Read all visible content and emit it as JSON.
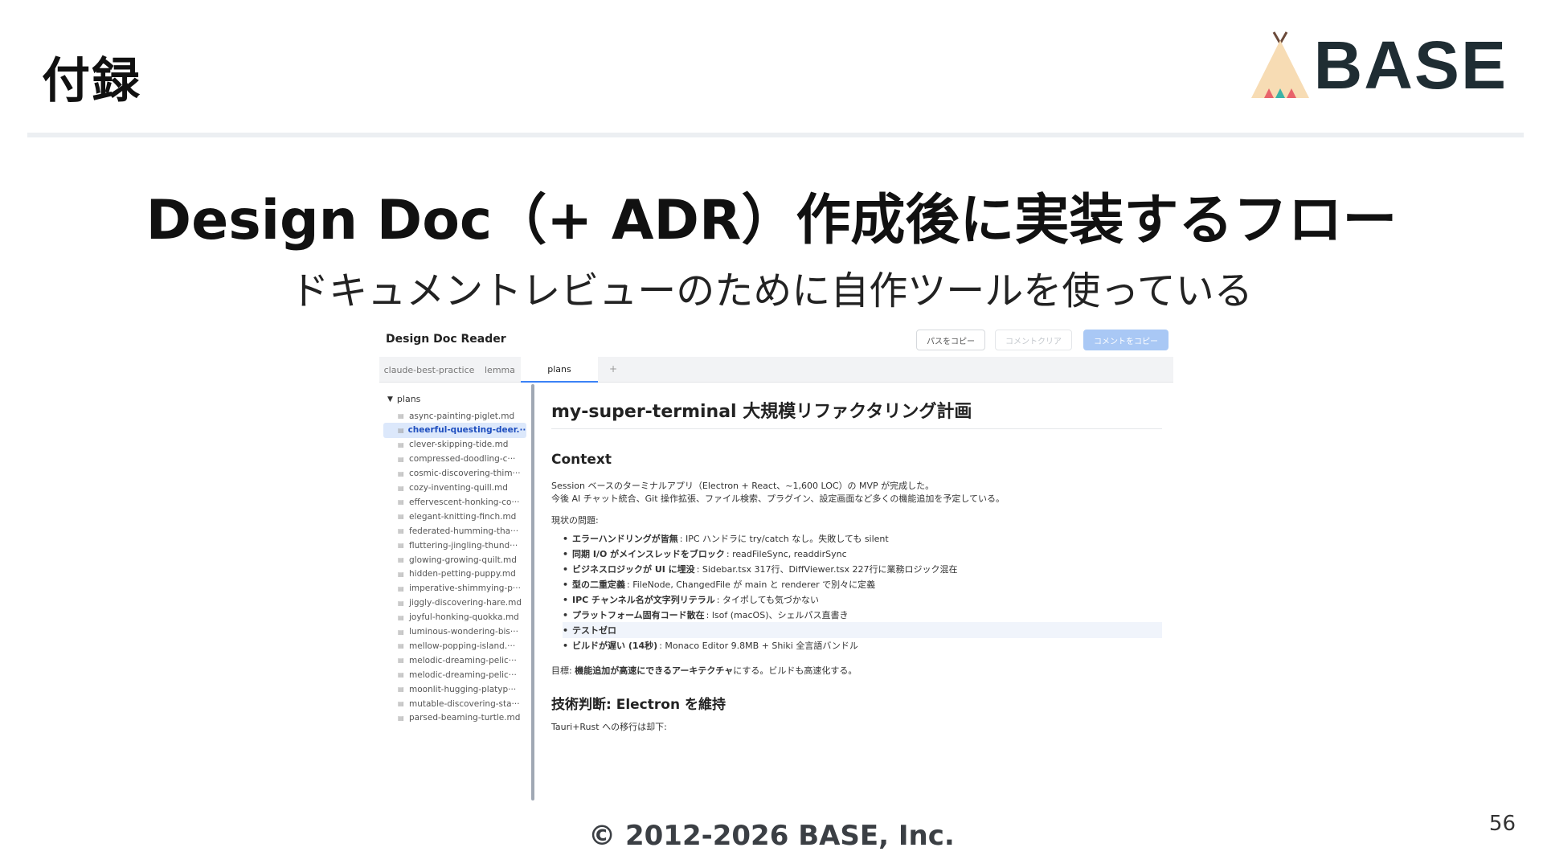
{
  "slide": {
    "heading": "付録",
    "logo_text": "BASE",
    "title": "Design Doc（+ ADR）作成後に実装するフロー",
    "subtitle": "ドキュメントレビューのために自作ツールを使っている",
    "copyright": "© 2012-2026 BASE, Inc.",
    "page_number": "56"
  },
  "app": {
    "title": "Design Doc Reader",
    "buttons": {
      "copy_path": "パスをコピー",
      "clear_comments": "コメントクリア",
      "copy_comments": "コメントをコピー"
    },
    "tabs": [
      {
        "label": "claude-best-practice"
      },
      {
        "label": "lemma"
      },
      {
        "label": "plans"
      }
    ],
    "tab_add": "+",
    "sidebar": {
      "root_arrow": "▼",
      "root_label": "plans",
      "items": [
        "async-painting-piglet.md",
        "cheerful-questing-deer.···",
        "clever-skipping-tide.md",
        "compressed-doodling-c···",
        "cosmic-discovering-thim···",
        "cozy-inventing-quill.md",
        "effervescent-honking-co···",
        "elegant-knitting-finch.md",
        "federated-humming-tha···",
        "fluttering-jingling-thund···",
        "glowing-growing-quilt.md",
        "hidden-petting-puppy.md",
        "imperative-shimmying-p···",
        "jiggly-discovering-hare.md",
        "joyful-honking-quokka.md",
        "luminous-wondering-bis···",
        "mellow-popping-island.···",
        "melodic-dreaming-pelic···",
        "melodic-dreaming-pelic···",
        "moonlit-hugging-platyp···",
        "mutable-discovering-sta···",
        "parsed-beaming-turtle.md"
      ],
      "selected_index": 1
    },
    "doc": {
      "h1": "my-super-terminal 大規模リファクタリング計画",
      "context_heading": "Context",
      "context_line1": "Session ベースのターミナルアプリ（Electron + React、~1,600 LOC）の MVP が完成した。",
      "context_line2": "今後 AI チャット統合、Git 操作拡張、ファイル検索、プラグイン、設定画面など多くの機能追加を予定している。",
      "problems_label": "現状の問題:",
      "problems": [
        {
          "bold": "エラーハンドリングが皆無",
          "text": ": IPC ハンドラに try/catch なし。失敗しても silent"
        },
        {
          "bold": "同期 I/O がメインスレッドをブロック",
          "text": ": readFileSync, readdirSync"
        },
        {
          "bold": "ビジネスロジックが UI に埋没",
          "text": ": Sidebar.tsx 317行、DiffViewer.tsx 227行に業務ロジック混在"
        },
        {
          "bold": "型の二重定義",
          "text": ": FileNode, ChangedFile が main と renderer で別々に定義"
        },
        {
          "bold": "IPC チャンネル名が文字列リテラル",
          "text": ": タイポしても気づかない"
        },
        {
          "bold": "プラットフォーム固有コード散在",
          "text": ": lsof (macOS)、シェルパス直書き"
        },
        {
          "bold": "テストゼロ",
          "text": ""
        },
        {
          "bold": "ビルドが遅い (14秒)",
          "text": ": Monaco Editor 9.8MB + Shiki 全言語バンドル"
        }
      ],
      "highlighted_problem_index": 6,
      "goal_prefix": "目標: ",
      "goal_bold": "機能追加が高速にできるアーキテクチャ",
      "goal_suffix": "にする。ビルドも高速化する。",
      "tech_heading": "技術判断: Electron を維持",
      "tech_line": "Tauri+Rust への移行は却下:"
    }
  },
  "colors": {
    "accent_blue": "#3b82f6",
    "primary_button": "#a9c8f5",
    "selected_bg": "#dce8fb",
    "logo_text": "#1f2d33",
    "logo_tent": "#f7dcb4",
    "logo_tri_red": "#e8636b",
    "logo_tri_teal": "#3bb3a7"
  }
}
